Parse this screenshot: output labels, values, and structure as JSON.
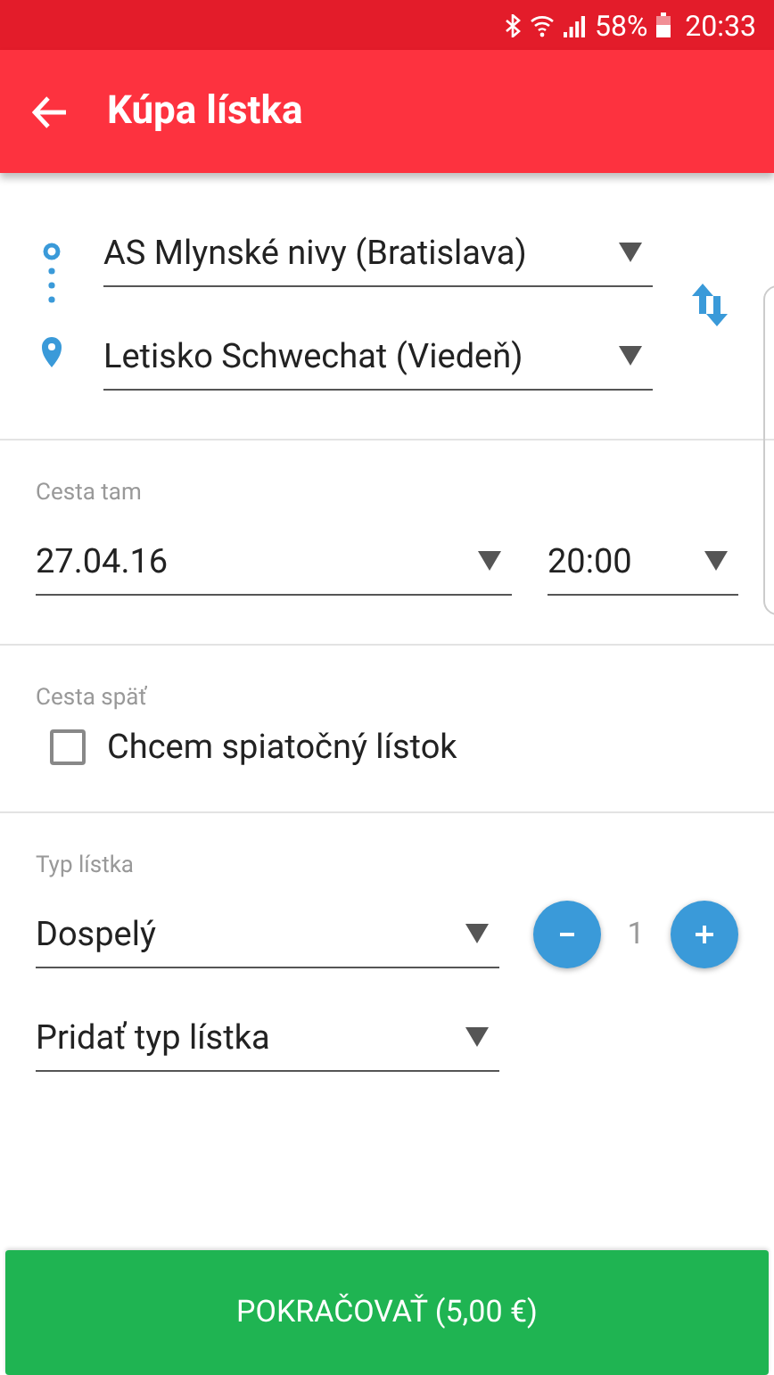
{
  "status_bar": {
    "battery": "58%",
    "time": "20:33"
  },
  "app_bar": {
    "title": "Kúpa lístka"
  },
  "route": {
    "from": "AS Mlynské nivy (Bratislava)",
    "to": "Letisko Schwechat (Viedeň)"
  },
  "outbound": {
    "label": "Cesta tam",
    "date": "27.04.16",
    "time": "20:00"
  },
  "return": {
    "label": "Cesta späť",
    "checkbox": {
      "label": "Chcem spiatočný lístok",
      "checked": false
    }
  },
  "tickets": {
    "label": "Typ lístka",
    "types": [
      {
        "name": "Dospelý",
        "count": "1"
      }
    ],
    "add": "Pridať typ lístka"
  },
  "continue_button": "POKRAČOVAŤ (5,00 €)"
}
